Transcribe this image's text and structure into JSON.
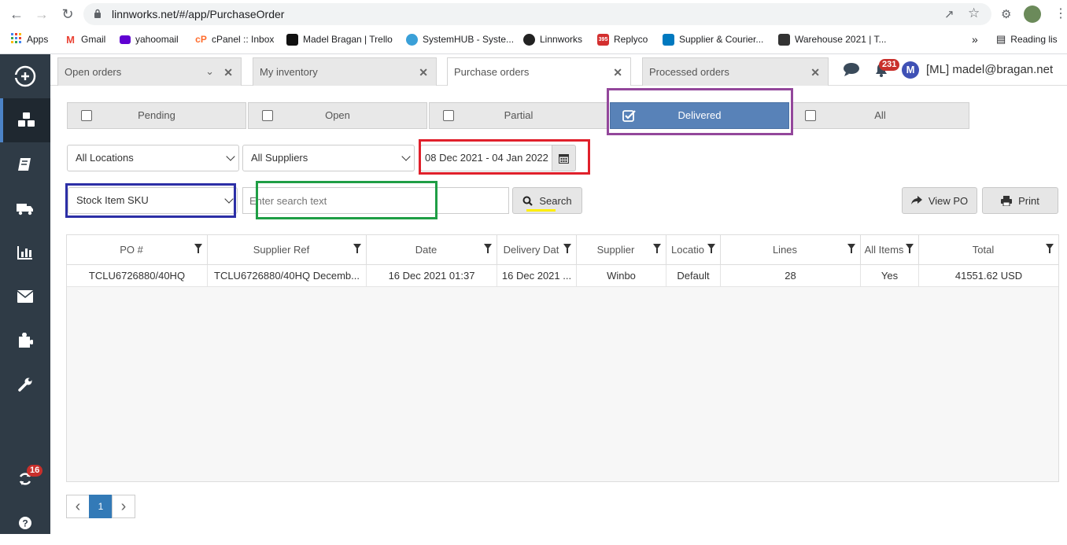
{
  "browser": {
    "url": "linnworks.net/#/app/PurchaseOrder",
    "bookmarks": [
      {
        "label": "Apps"
      },
      {
        "label": "Gmail"
      },
      {
        "label": "yahoomail"
      },
      {
        "label": "cPanel :: Inbox"
      },
      {
        "label": "Madel Bragan | Trello"
      },
      {
        "label": "SystemHUB - Syste..."
      },
      {
        "label": "Linnworks"
      },
      {
        "label": "Replyco"
      },
      {
        "label": "Supplier & Courier..."
      },
      {
        "label": "Warehouse 2021 | T..."
      }
    ],
    "reading_list": "Reading lis",
    "more": "»"
  },
  "sidebar": {
    "sync_badge": "16"
  },
  "tabs": [
    {
      "label": "Open orders"
    },
    {
      "label": "My inventory"
    },
    {
      "label": "Purchase orders"
    },
    {
      "label": "Processed orders"
    }
  ],
  "header": {
    "notif_count": "231",
    "avatar_letter": "M",
    "user": "[ML] madel@bragan.net"
  },
  "status_filters": [
    {
      "label": "Pending",
      "checked": false
    },
    {
      "label": "Open",
      "checked": false
    },
    {
      "label": "Partial",
      "checked": false
    },
    {
      "label": "Delivered",
      "checked": true
    },
    {
      "label": "All",
      "checked": false
    }
  ],
  "filters": {
    "location": "All Locations",
    "supplier": "All Suppliers",
    "date_range": "08 Dec 2021 - 04 Jan 2022",
    "search_type": "Stock Item SKU",
    "search_placeholder": "Enter search text",
    "search_button": "Search",
    "view_po": "View PO",
    "print": "Print"
  },
  "grid": {
    "columns": [
      "PO #",
      "Supplier Ref",
      "Date",
      "Delivery Dat",
      "Supplier",
      "Locatio",
      "Lines",
      "All Items",
      "Total"
    ],
    "rows": [
      [
        "TCLU6726880/40HQ",
        "TCLU6726880/40HQ Decemb...",
        "16 Dec 2021 01:37",
        "16 Dec 2021 ...",
        "Winbo",
        "Default",
        "28",
        "Yes",
        "41551.62 USD"
      ]
    ]
  },
  "pager": {
    "current": "1",
    "prev": "‹",
    "next": "›"
  },
  "colors": {
    "sidebar": "#2f3b46",
    "delivered": "#5882b8",
    "highlight_purple": "#93479b",
    "highlight_red": "#e0202b",
    "highlight_blue": "#2c2fa6",
    "highlight_green": "#1f9e45",
    "highlight_yellow": "#ffee00"
  }
}
